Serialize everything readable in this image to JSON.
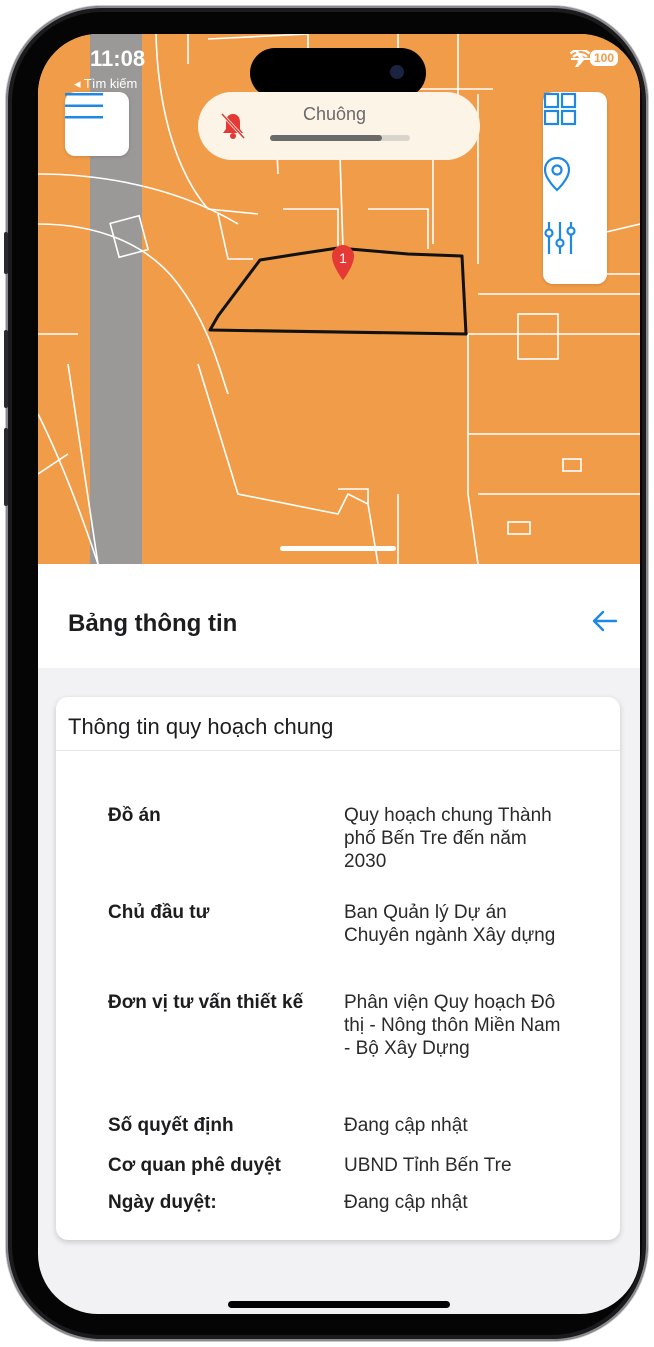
{
  "status_bar": {
    "time": "11:08",
    "back_label": "◂ Tìm kiếm",
    "battery": "100"
  },
  "notification": {
    "label": "Chuông",
    "level": 0.8
  },
  "map": {
    "marker_label": "1",
    "map_color": "#f19c48"
  },
  "panel": {
    "title": "Bảng thông tin"
  },
  "card": {
    "title": "Thông tin quy hoạch chung",
    "rows": [
      {
        "label": "Đồ án",
        "value": "Quy hoạch chung Thành phố Bến Tre đến năm 2030"
      },
      {
        "label": "Chủ đầu tư",
        "value": "Ban Quản lý Dự án Chuyên ngành Xây dựng"
      },
      {
        "label": "Đơn vị tư vấn thiết kế",
        "value": "Phân viện Quy hoạch Đô thị - Nông thôn Miền Nam - Bộ Xây Dựng"
      },
      {
        "label": "Số quyết định",
        "value": "Đang cập nhật"
      },
      {
        "label": "Cơ quan phê duyệt",
        "value": "UBND Tỉnh Bến Tre"
      },
      {
        "label": "Ngày duyệt:",
        "value": "Đang cập nhật"
      }
    ]
  },
  "colors": {
    "accent": "#1e88e5",
    "map_fill": "#f19c48",
    "bell_muted": "#e53935"
  }
}
